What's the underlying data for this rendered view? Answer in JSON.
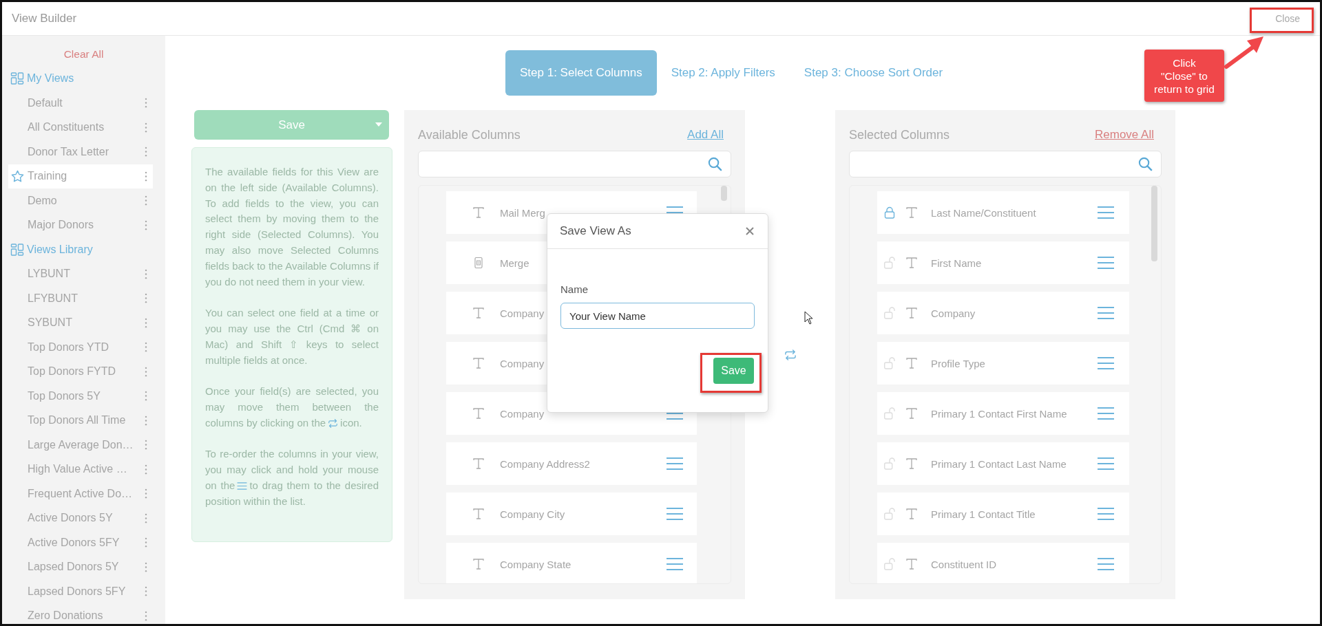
{
  "window": {
    "title": "View Builder",
    "close": "Close"
  },
  "sidebar": {
    "clear_all": "Clear All",
    "groups": [
      {
        "title": "My Views",
        "items": [
          {
            "label": "Default",
            "selected": false,
            "starred": false
          },
          {
            "label": "All Constituents",
            "selected": false,
            "starred": false
          },
          {
            "label": "Donor Tax Letter",
            "selected": false,
            "starred": false
          },
          {
            "label": "Training",
            "selected": true,
            "starred": true
          },
          {
            "label": "Demo",
            "selected": false,
            "starred": false
          },
          {
            "label": "Major Donors",
            "selected": false,
            "starred": false
          }
        ]
      },
      {
        "title": "Views Library",
        "items": [
          {
            "label": "LYBUNT",
            "selected": false,
            "starred": false
          },
          {
            "label": "LFYBUNT",
            "selected": false,
            "starred": false
          },
          {
            "label": "SYBUNT",
            "selected": false,
            "starred": false
          },
          {
            "label": "Top Donors YTD",
            "selected": false,
            "starred": false
          },
          {
            "label": "Top Donors FYTD",
            "selected": false,
            "starred": false
          },
          {
            "label": "Top Donors 5Y",
            "selected": false,
            "starred": false
          },
          {
            "label": "Top Donors All Time",
            "selected": false,
            "starred": false
          },
          {
            "label": "Large Average Don…",
            "selected": false,
            "starred": false
          },
          {
            "label": "High Value Active …",
            "selected": false,
            "starred": false
          },
          {
            "label": "Frequent Active Do…",
            "selected": false,
            "starred": false
          },
          {
            "label": "Active Donors 5Y",
            "selected": false,
            "starred": false
          },
          {
            "label": "Active Donors 5FY",
            "selected": false,
            "starred": false
          },
          {
            "label": "Lapsed Donors 5Y",
            "selected": false,
            "starred": false
          },
          {
            "label": "Lapsed Donors 5FY",
            "selected": false,
            "starred": false
          },
          {
            "label": "Zero Donations",
            "selected": false,
            "starred": false
          }
        ]
      }
    ]
  },
  "steps": [
    {
      "label": "Step 1: Select Columns",
      "selected": true
    },
    {
      "label": "Step 2: Apply Filters",
      "selected": false
    },
    {
      "label": "Step 3: Choose Sort Order",
      "selected": false
    }
  ],
  "save_button": "Save",
  "help": [
    {
      "kind": "plain",
      "text": "The available fields for this View are on the left side (Available Columns). To add fields to the view, you can select them by moving them to the right side (Selected Columns). You may also move Selected Columns fields back to the Available Columns if you do not need them in your view."
    },
    {
      "kind": "plain",
      "text": "You can select one field at a time or you may use the Ctrl (Cmd ⌘ on Mac) and Shift ⇧ keys to select multiple fields at once."
    },
    {
      "kind": "swap",
      "text": "Once your field(s) are selected, you may move them between the columns by clicking on the",
      "after": "icon."
    },
    {
      "kind": "drag",
      "text": "To re-order the columns in your view, you may click and hold your mouse on the",
      "after": "to drag them to the desired position within the list."
    }
  ],
  "available": {
    "title": "Available Columns",
    "action": "Add All",
    "rows": [
      {
        "label": "Mail Merg",
        "kind": "text",
        "handle": true
      },
      {
        "label": "Merge",
        "kind": "document",
        "handle": false
      },
      {
        "label": "Company",
        "kind": "text",
        "handle": false
      },
      {
        "label": "Company",
        "kind": "text",
        "handle": false
      },
      {
        "label": "Company",
        "kind": "text",
        "handle": true
      },
      {
        "label": "Company Address2",
        "kind": "text",
        "handle": true
      },
      {
        "label": "Company City",
        "kind": "text",
        "handle": true
      },
      {
        "label": "Company State",
        "kind": "text",
        "handle": true
      }
    ]
  },
  "selected": {
    "title": "Selected Columns",
    "action": "Remove All",
    "rows": [
      {
        "label": "Last Name/Constituent",
        "locked": true
      },
      {
        "label": "First Name",
        "locked": false
      },
      {
        "label": "Company",
        "locked": false
      },
      {
        "label": "Profile Type",
        "locked": false
      },
      {
        "label": "Primary 1 Contact First Name",
        "locked": false
      },
      {
        "label": "Primary 1 Contact Last Name",
        "locked": false
      },
      {
        "label": "Primary 1 Contact Title",
        "locked": false
      },
      {
        "label": "Constituent ID",
        "locked": false
      }
    ]
  },
  "dialog": {
    "title": "Save View As",
    "field_label": "Name",
    "value": "Your View Name",
    "button": "Save"
  },
  "callout": {
    "text": "Click\n\"Close\" to\nreturn to grid"
  }
}
